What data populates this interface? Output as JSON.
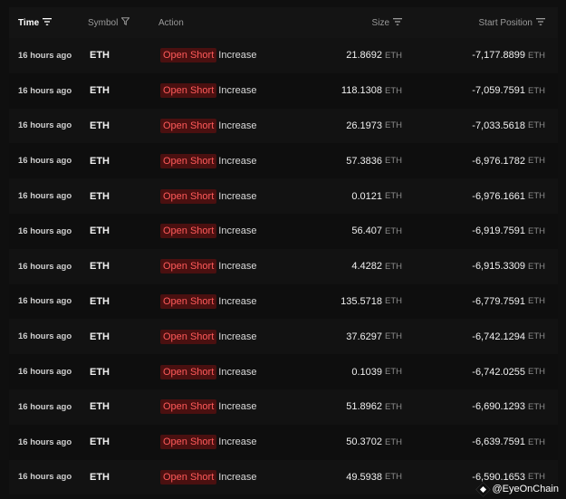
{
  "header": {
    "time": "Time",
    "symbol": "Symbol",
    "action": "Action",
    "size": "Size",
    "start_position": "Start Position"
  },
  "rows": [
    {
      "time": "16 hours ago",
      "symbol": "ETH",
      "action": "Open Short",
      "action_detail": "Increase",
      "size": "21.8692",
      "size_unit": "ETH",
      "start": "-7,177.8899",
      "start_unit": "ETH"
    },
    {
      "time": "16 hours ago",
      "symbol": "ETH",
      "action": "Open Short",
      "action_detail": "Increase",
      "size": "118.1308",
      "size_unit": "ETH",
      "start": "-7,059.7591",
      "start_unit": "ETH"
    },
    {
      "time": "16 hours ago",
      "symbol": "ETH",
      "action": "Open Short",
      "action_detail": "Increase",
      "size": "26.1973",
      "size_unit": "ETH",
      "start": "-7,033.5618",
      "start_unit": "ETH"
    },
    {
      "time": "16 hours ago",
      "symbol": "ETH",
      "action": "Open Short",
      "action_detail": "Increase",
      "size": "57.3836",
      "size_unit": "ETH",
      "start": "-6,976.1782",
      "start_unit": "ETH"
    },
    {
      "time": "16 hours ago",
      "symbol": "ETH",
      "action": "Open Short",
      "action_detail": "Increase",
      "size": "0.0121",
      "size_unit": "ETH",
      "start": "-6,976.1661",
      "start_unit": "ETH"
    },
    {
      "time": "16 hours ago",
      "symbol": "ETH",
      "action": "Open Short",
      "action_detail": "Increase",
      "size": "56.407",
      "size_unit": "ETH",
      "start": "-6,919.7591",
      "start_unit": "ETH"
    },
    {
      "time": "16 hours ago",
      "symbol": "ETH",
      "action": "Open Short",
      "action_detail": "Increase",
      "size": "4.4282",
      "size_unit": "ETH",
      "start": "-6,915.3309",
      "start_unit": "ETH"
    },
    {
      "time": "16 hours ago",
      "symbol": "ETH",
      "action": "Open Short",
      "action_detail": "Increase",
      "size": "135.5718",
      "size_unit": "ETH",
      "start": "-6,779.7591",
      "start_unit": "ETH"
    },
    {
      "time": "16 hours ago",
      "symbol": "ETH",
      "action": "Open Short",
      "action_detail": "Increase",
      "size": "37.6297",
      "size_unit": "ETH",
      "start": "-6,742.1294",
      "start_unit": "ETH"
    },
    {
      "time": "16 hours ago",
      "symbol": "ETH",
      "action": "Open Short",
      "action_detail": "Increase",
      "size": "0.1039",
      "size_unit": "ETH",
      "start": "-6,742.0255",
      "start_unit": "ETH"
    },
    {
      "time": "16 hours ago",
      "symbol": "ETH",
      "action": "Open Short",
      "action_detail": "Increase",
      "size": "51.8962",
      "size_unit": "ETH",
      "start": "-6,690.1293",
      "start_unit": "ETH"
    },
    {
      "time": "16 hours ago",
      "symbol": "ETH",
      "action": "Open Short",
      "action_detail": "Increase",
      "size": "50.3702",
      "size_unit": "ETH",
      "start": "-6,639.7591",
      "start_unit": "ETH"
    },
    {
      "time": "16 hours ago",
      "symbol": "ETH",
      "action": "Open Short",
      "action_detail": "Increase",
      "size": "49.5938",
      "size_unit": "ETH",
      "start": "-6,590.1653",
      "start_unit": "ETH"
    }
  ],
  "watermark": "@EyeOnChain",
  "colors": {
    "short_badge_bg": "#4a1010",
    "short_badge_text": "#ff5a5a",
    "background": "#0f0f0f"
  }
}
